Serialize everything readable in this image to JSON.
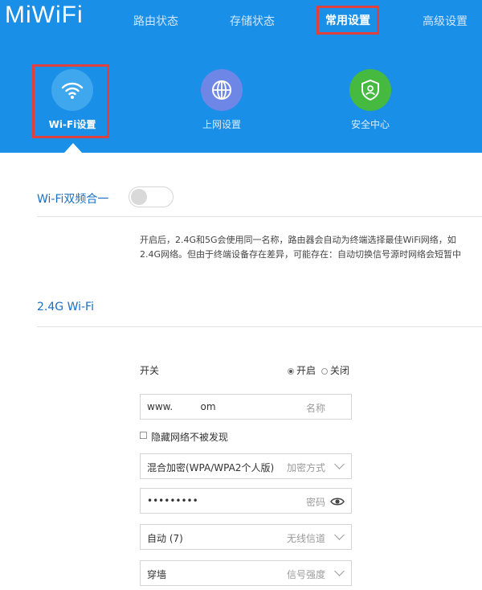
{
  "app": {
    "logo": "MiWiFi"
  },
  "nav": {
    "items": [
      {
        "label": "路由状态"
      },
      {
        "label": "存储状态"
      },
      {
        "label": "常用设置"
      },
      {
        "label": "高级设置"
      }
    ]
  },
  "features": [
    {
      "label": "Wi-Fi设置",
      "icon": "wifi-icon",
      "color": "#3fa7ee"
    },
    {
      "label": "上网设置",
      "icon": "globe-icon",
      "color": "#6e87e6"
    },
    {
      "label": "安全中心",
      "icon": "shield-icon",
      "color": "#45b940"
    }
  ],
  "dual_band": {
    "label": "Wi-Fi双频合一",
    "enabled": false,
    "description_line1": "开启后，2.4G和5G会使用同一名称，路由器会自动为终端选择最佳WiFi网络，如",
    "description_line2": "2.4G网络。但由于终端设备存在差异，可能存在：自动切换信号源时网络会短暂中"
  },
  "wifi24": {
    "section_title": "2.4G Wi-Fi",
    "switch_label": "开关",
    "on_label": "开启",
    "off_label": "关闭",
    "name_value": "www.         om",
    "name_hint": "名称",
    "hide_label": "隐藏网络不被发现",
    "encryption_value": "混合加密(WPA/WPA2个人版)",
    "encryption_hint": "加密方式",
    "password_value": "•••••••••",
    "password_hint": "密码",
    "channel_value": "自动 (7)",
    "channel_hint": "无线信道",
    "strength_value": "穿墙",
    "strength_hint": "信号强度"
  }
}
